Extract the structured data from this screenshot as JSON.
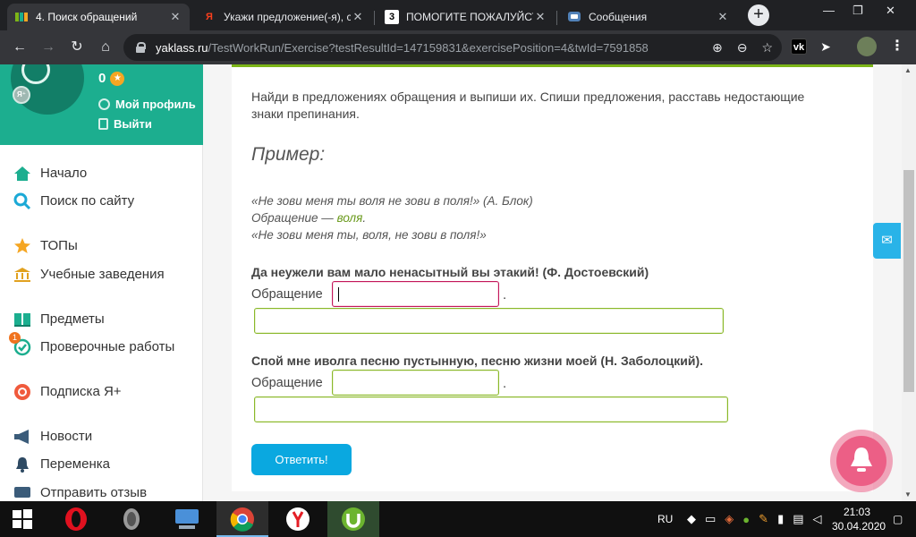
{
  "tabs": [
    {
      "title": "4. Поиск обращений",
      "active": true,
      "icon": "yaklass-icon"
    },
    {
      "title": "Укажи предложение(-я), с",
      "active": false,
      "icon": "yandex-icon"
    },
    {
      "title": "ПОМОГИТЕ ПОЖАЛУЙСТ",
      "active": false,
      "icon": "znanija-icon"
    },
    {
      "title": "Сообщения",
      "active": false,
      "icon": "vk-messages-icon"
    }
  ],
  "address": {
    "host": "yaklass.ru",
    "path": "/TestWorkRun/Exercise?testResultId=147159831&exercisePosition=4&twId=7591858"
  },
  "user": {
    "score": "0",
    "profile_label": "Мой профиль",
    "logout_label": "Выйти"
  },
  "nav": {
    "home": "Начало",
    "search": "Поиск по сайту",
    "tops": "ТОПы",
    "schools": "Учебные заведения",
    "subjects": "Предметы",
    "tests": "Проверочные работы",
    "tests_badge": "1",
    "subscription": "Подписка Я+",
    "news": "Новости",
    "break": "Переменка",
    "feedback": "Отправить отзыв"
  },
  "exercise": {
    "instruction": "Найди в предложениях обращения и выпиши их. Спиши предложения, расставь недостающие знаки препинания.",
    "example_title": "Пример:",
    "example_line1": "«Не зови меня ты воля не зови в поля!» (А. Блок)",
    "example_line2_prefix": "Обращение — ",
    "example_line2_word": "воля",
    "example_line2_suffix": ".",
    "example_line3": "«Не зови меня ты, воля, не зови в поля!»",
    "q1_text": "Да неужели вам мало ненасытный вы этакий! (Ф. Достоевский)",
    "q1_label": "Обращение",
    "q1_value": "",
    "q1_sentence_value": "",
    "q2_text": "Спой мне иволга песню пустынную, песню жизни моей (Н. Заболоцкий).",
    "q2_label": "Обращение",
    "q2_value": "",
    "q2_sentence_value": "",
    "period": ".",
    "submit_label": "Ответить!"
  },
  "taskbar": {
    "lang": "RU",
    "time": "21:03",
    "date": "30.04.2020"
  },
  "colors": {
    "sidebar_green": "#1cae8f",
    "accent_lime": "#7cb518",
    "button_blue": "#0aa8e0",
    "bell_pink": "#ec5f86"
  }
}
